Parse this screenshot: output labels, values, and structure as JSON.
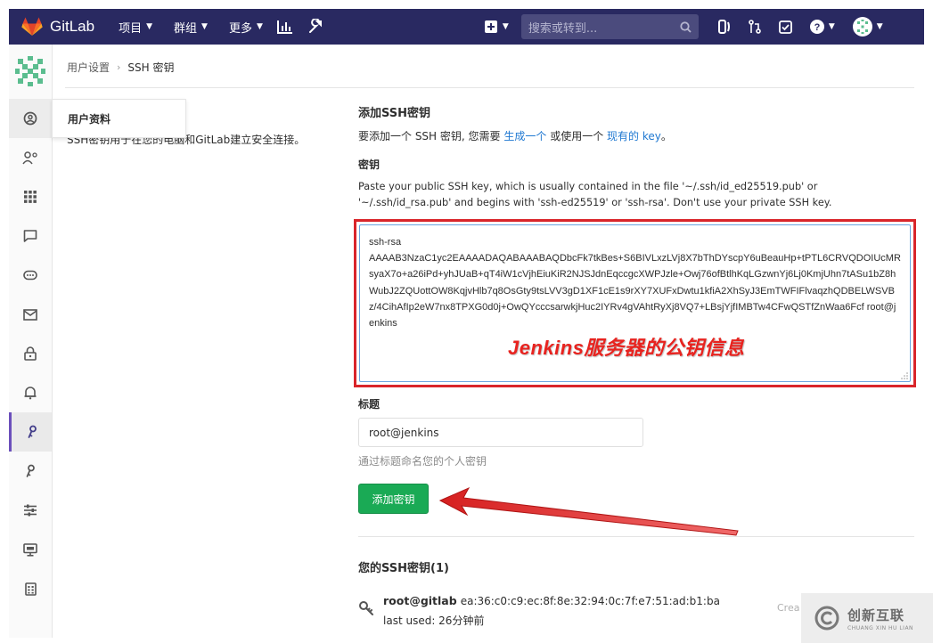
{
  "header": {
    "app_name": "GitLab",
    "nav": [
      {
        "label": "项目"
      },
      {
        "label": "群组"
      },
      {
        "label": "更多"
      }
    ],
    "search_placeholder": "搜索或转到...",
    "colors": {
      "bar": "#292961",
      "search": "#4b4b7d",
      "logo": "#e24329"
    }
  },
  "breadcrumb": {
    "parent": "用户设置",
    "current": "SSH 密钥"
  },
  "sidebar": {
    "items": [
      {
        "icon": "profile-icon"
      },
      {
        "icon": "account-icon"
      },
      {
        "icon": "applications-icon"
      },
      {
        "icon": "chat-icon"
      },
      {
        "icon": "access-tokens-icon"
      },
      {
        "icon": "emails-icon"
      },
      {
        "icon": "password-icon"
      },
      {
        "icon": "notifications-icon"
      },
      {
        "icon": "ssh-key-icon",
        "active": true
      },
      {
        "icon": "gpg-key-icon"
      },
      {
        "icon": "preferences-icon"
      },
      {
        "icon": "sessions-icon"
      },
      {
        "icon": "audit-log-icon"
      }
    ]
  },
  "profile_popover": {
    "label": "用户资料"
  },
  "left_panel": {
    "description": "SSH密钥用于在您的电脑和GitLab建立安全连接。"
  },
  "form": {
    "add_heading": "添加SSH密钥",
    "add_desc_prefix": "要添加一个 SSH 密钥, 您需要",
    "add_desc_link1": "生成一个",
    "add_desc_middle": "或使用一个",
    "add_desc_link2": "现有的 key",
    "add_desc_suffix": "。",
    "key_label": "密钥",
    "key_help": "Paste your public SSH key, which is usually contained in the file '~/.ssh/id_ed25519.pub' or '~/.ssh/id_rsa.pub' and begins with 'ssh-ed25519' or 'ssh-rsa'. Don't use your private SSH key.",
    "key_value": "ssh-rsa\nAAAAB3NzaC1yc2EAAAADAQABAAABAQDbcFk7tkBes+S6BIVLxzLVj8X7bThDYscpY6uBeauHp+tPTL6CRVQDOIUcMRsyaX7o+a26iPd+yhJUaB+qT4iW1cVjhEiuKiR2NJSJdnEqccgcXWPJzle+Owj76ofBtlhKqLGzwnYj6Lj0KmjUhn7tASu1bZ8hWubJ2ZQUottOW8KqjvHlb7q8OsGty9tsLVV3gD1XF1cE1s9rXY7XUFxDwtu1kfiA2XhSyJ3EmTWFIFlvaqzhQDBELWSVBz/4CihAfIp2eW7nx8TPXG0d0j+OwQYcccsarwkjHuc2IYRv4gVAhtRyXj8VQ7+LBsjYjfIMBTw4CFwQSTfZnWaa6Fcf root@jenkins",
    "annotation": "Jenkins服务器的公钥信息",
    "title_label": "标题",
    "title_value": "root@jenkins",
    "title_help": "通过标题命名您的个人密钥",
    "submit_label": "添加密钥",
    "colors": {
      "highlight": "#d9252a",
      "button": "#1aaa55",
      "link": "#1f78d1"
    }
  },
  "keys_section": {
    "heading": "您的SSH密钥(1)",
    "keys": [
      {
        "name": "root@gitlab",
        "fingerprint": "ea:36:c0:c9:ec:8f:8e:32:94:0c:7f:e7:51:ad:b1:ba",
        "last_used": "last used: 26分钟前",
        "created": "Crea"
      }
    ]
  },
  "watermark": {
    "title": "创新互联",
    "subtitle": "CHUANG XIN HU LIAN"
  }
}
